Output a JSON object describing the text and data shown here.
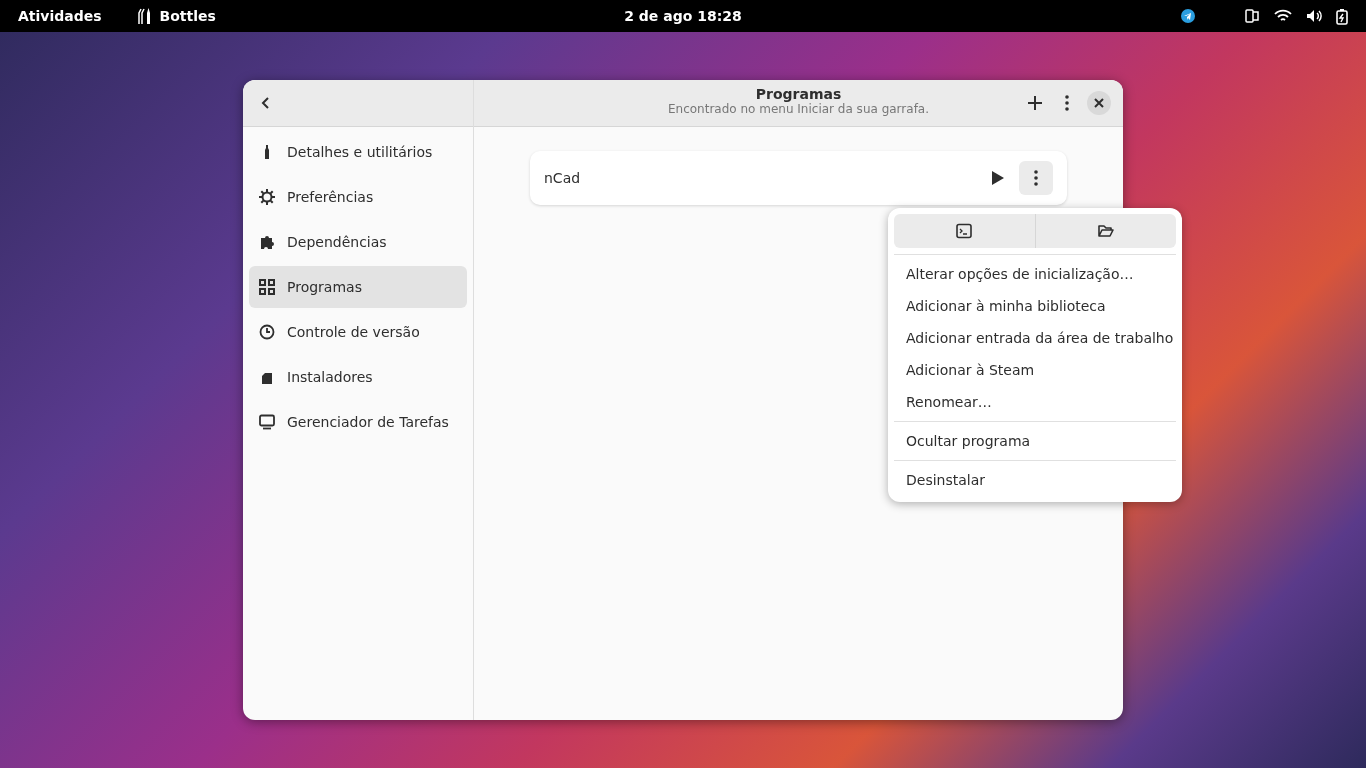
{
  "top_bar": {
    "activities": "Atividades",
    "app_name": "Bottles",
    "clock": "2 de ago  18:28"
  },
  "window": {
    "title": "Programas",
    "subtitle": "Encontrado no menu Iniciar da sua garrafa."
  },
  "sidebar": {
    "items": [
      {
        "label": "Detalhes e utilitários",
        "selected": false
      },
      {
        "label": "Preferências",
        "selected": false
      },
      {
        "label": "Dependências",
        "selected": false
      },
      {
        "label": "Programas",
        "selected": true
      },
      {
        "label": "Controle de versão",
        "selected": false
      },
      {
        "label": "Instaladores",
        "selected": false
      },
      {
        "label": "Gerenciador de Tarefas",
        "selected": false
      }
    ]
  },
  "programs": [
    {
      "name": "nCad"
    }
  ],
  "menu": {
    "groups": [
      [
        "Alterar opções de inicialização…",
        "Adicionar à minha biblioteca",
        "Adicionar entrada da área de trabalho",
        "Adicionar à Steam",
        "Renomear…"
      ],
      [
        "Ocultar programa"
      ],
      [
        "Desinstalar"
      ]
    ]
  }
}
